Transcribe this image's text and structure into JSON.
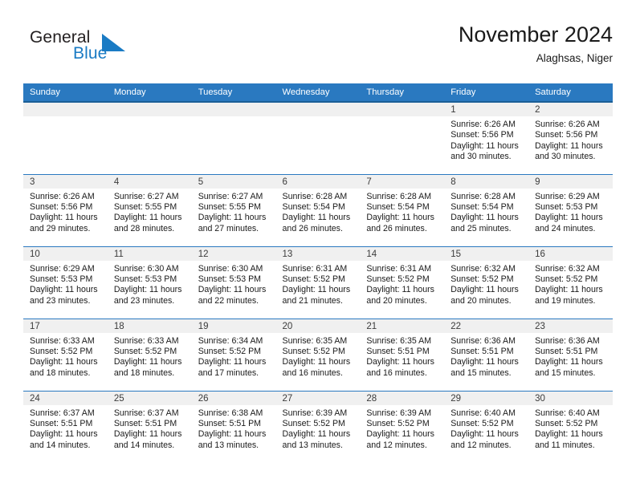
{
  "brand": {
    "name_part1": "General",
    "name_part2": "Blue",
    "triangle_color": "#1a7bc4",
    "icon": "triangle-logo-icon"
  },
  "header": {
    "title": "November 2024",
    "subtitle": "Alaghsas, Niger"
  },
  "theme": {
    "header_blue": "#2a79c0",
    "header_border": "#1b5e96",
    "daynum_bg": "#f0f0f0",
    "text": "#1a1a1a"
  },
  "weekdays": [
    "Sunday",
    "Monday",
    "Tuesday",
    "Wednesday",
    "Thursday",
    "Friday",
    "Saturday"
  ],
  "weeks": [
    [
      {
        "day": "",
        "empty": true
      },
      {
        "day": "",
        "empty": true
      },
      {
        "day": "",
        "empty": true
      },
      {
        "day": "",
        "empty": true
      },
      {
        "day": "",
        "empty": true
      },
      {
        "day": "1",
        "sunrise": "Sunrise: 6:26 AM",
        "sunset": "Sunset: 5:56 PM",
        "daylight": "Daylight: 11 hours and 30 minutes."
      },
      {
        "day": "2",
        "sunrise": "Sunrise: 6:26 AM",
        "sunset": "Sunset: 5:56 PM",
        "daylight": "Daylight: 11 hours and 30 minutes."
      }
    ],
    [
      {
        "day": "3",
        "sunrise": "Sunrise: 6:26 AM",
        "sunset": "Sunset: 5:56 PM",
        "daylight": "Daylight: 11 hours and 29 minutes."
      },
      {
        "day": "4",
        "sunrise": "Sunrise: 6:27 AM",
        "sunset": "Sunset: 5:55 PM",
        "daylight": "Daylight: 11 hours and 28 minutes."
      },
      {
        "day": "5",
        "sunrise": "Sunrise: 6:27 AM",
        "sunset": "Sunset: 5:55 PM",
        "daylight": "Daylight: 11 hours and 27 minutes."
      },
      {
        "day": "6",
        "sunrise": "Sunrise: 6:28 AM",
        "sunset": "Sunset: 5:54 PM",
        "daylight": "Daylight: 11 hours and 26 minutes."
      },
      {
        "day": "7",
        "sunrise": "Sunrise: 6:28 AM",
        "sunset": "Sunset: 5:54 PM",
        "daylight": "Daylight: 11 hours and 26 minutes."
      },
      {
        "day": "8",
        "sunrise": "Sunrise: 6:28 AM",
        "sunset": "Sunset: 5:54 PM",
        "daylight": "Daylight: 11 hours and 25 minutes."
      },
      {
        "day": "9",
        "sunrise": "Sunrise: 6:29 AM",
        "sunset": "Sunset: 5:53 PM",
        "daylight": "Daylight: 11 hours and 24 minutes."
      }
    ],
    [
      {
        "day": "10",
        "sunrise": "Sunrise: 6:29 AM",
        "sunset": "Sunset: 5:53 PM",
        "daylight": "Daylight: 11 hours and 23 minutes."
      },
      {
        "day": "11",
        "sunrise": "Sunrise: 6:30 AM",
        "sunset": "Sunset: 5:53 PM",
        "daylight": "Daylight: 11 hours and 23 minutes."
      },
      {
        "day": "12",
        "sunrise": "Sunrise: 6:30 AM",
        "sunset": "Sunset: 5:53 PM",
        "daylight": "Daylight: 11 hours and 22 minutes."
      },
      {
        "day": "13",
        "sunrise": "Sunrise: 6:31 AM",
        "sunset": "Sunset: 5:52 PM",
        "daylight": "Daylight: 11 hours and 21 minutes."
      },
      {
        "day": "14",
        "sunrise": "Sunrise: 6:31 AM",
        "sunset": "Sunset: 5:52 PM",
        "daylight": "Daylight: 11 hours and 20 minutes."
      },
      {
        "day": "15",
        "sunrise": "Sunrise: 6:32 AM",
        "sunset": "Sunset: 5:52 PM",
        "daylight": "Daylight: 11 hours and 20 minutes."
      },
      {
        "day": "16",
        "sunrise": "Sunrise: 6:32 AM",
        "sunset": "Sunset: 5:52 PM",
        "daylight": "Daylight: 11 hours and 19 minutes."
      }
    ],
    [
      {
        "day": "17",
        "sunrise": "Sunrise: 6:33 AM",
        "sunset": "Sunset: 5:52 PM",
        "daylight": "Daylight: 11 hours and 18 minutes."
      },
      {
        "day": "18",
        "sunrise": "Sunrise: 6:33 AM",
        "sunset": "Sunset: 5:52 PM",
        "daylight": "Daylight: 11 hours and 18 minutes."
      },
      {
        "day": "19",
        "sunrise": "Sunrise: 6:34 AM",
        "sunset": "Sunset: 5:52 PM",
        "daylight": "Daylight: 11 hours and 17 minutes."
      },
      {
        "day": "20",
        "sunrise": "Sunrise: 6:35 AM",
        "sunset": "Sunset: 5:52 PM",
        "daylight": "Daylight: 11 hours and 16 minutes."
      },
      {
        "day": "21",
        "sunrise": "Sunrise: 6:35 AM",
        "sunset": "Sunset: 5:51 PM",
        "daylight": "Daylight: 11 hours and 16 minutes."
      },
      {
        "day": "22",
        "sunrise": "Sunrise: 6:36 AM",
        "sunset": "Sunset: 5:51 PM",
        "daylight": "Daylight: 11 hours and 15 minutes."
      },
      {
        "day": "23",
        "sunrise": "Sunrise: 6:36 AM",
        "sunset": "Sunset: 5:51 PM",
        "daylight": "Daylight: 11 hours and 15 minutes."
      }
    ],
    [
      {
        "day": "24",
        "sunrise": "Sunrise: 6:37 AM",
        "sunset": "Sunset: 5:51 PM",
        "daylight": "Daylight: 11 hours and 14 minutes."
      },
      {
        "day": "25",
        "sunrise": "Sunrise: 6:37 AM",
        "sunset": "Sunset: 5:51 PM",
        "daylight": "Daylight: 11 hours and 14 minutes."
      },
      {
        "day": "26",
        "sunrise": "Sunrise: 6:38 AM",
        "sunset": "Sunset: 5:51 PM",
        "daylight": "Daylight: 11 hours and 13 minutes."
      },
      {
        "day": "27",
        "sunrise": "Sunrise: 6:39 AM",
        "sunset": "Sunset: 5:52 PM",
        "daylight": "Daylight: 11 hours and 13 minutes."
      },
      {
        "day": "28",
        "sunrise": "Sunrise: 6:39 AM",
        "sunset": "Sunset: 5:52 PM",
        "daylight": "Daylight: 11 hours and 12 minutes."
      },
      {
        "day": "29",
        "sunrise": "Sunrise: 6:40 AM",
        "sunset": "Sunset: 5:52 PM",
        "daylight": "Daylight: 11 hours and 12 minutes."
      },
      {
        "day": "30",
        "sunrise": "Sunrise: 6:40 AM",
        "sunset": "Sunset: 5:52 PM",
        "daylight": "Daylight: 11 hours and 11 minutes."
      }
    ]
  ]
}
